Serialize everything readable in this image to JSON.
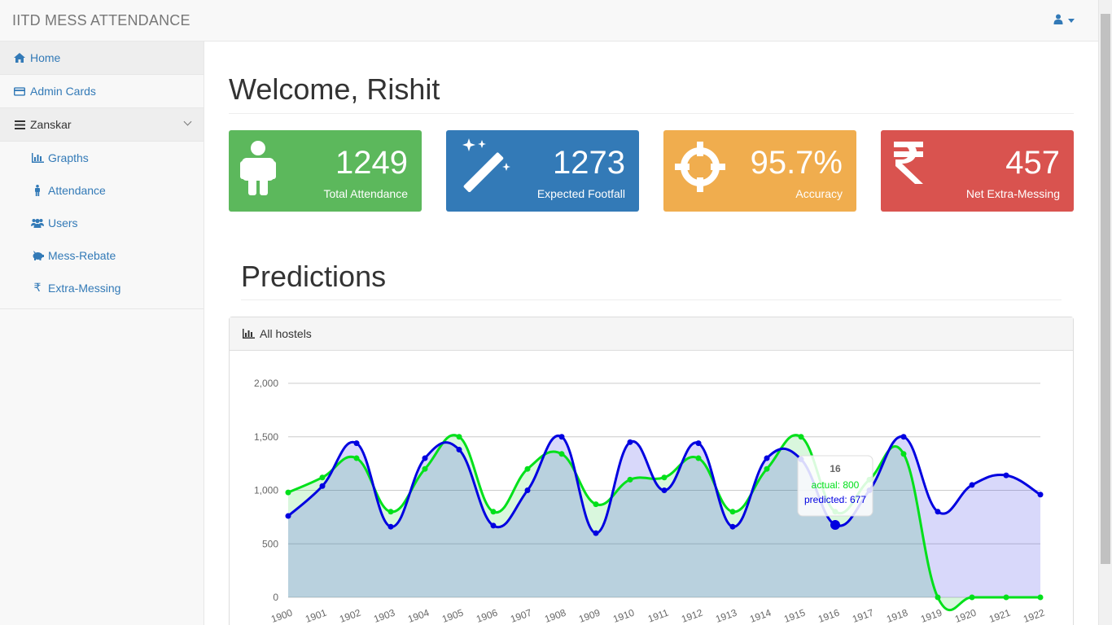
{
  "app": {
    "brand": "IITD MESS ATTENDANCE"
  },
  "header": {
    "user_icon": "user-icon"
  },
  "sidebar": {
    "items": [
      {
        "label": "Home",
        "icon": "home-icon"
      },
      {
        "label": "Admin Cards",
        "icon": "credit-card-icon"
      },
      {
        "label": "Zanskar",
        "icon": "bars-icon"
      }
    ],
    "sub_items": [
      {
        "label": "Grapths",
        "icon": "bar-chart-icon"
      },
      {
        "label": "Attendance",
        "icon": "male-icon"
      },
      {
        "label": "Users",
        "icon": "users-icon"
      },
      {
        "label": "Mess-Rebate",
        "icon": "piggy-bank-icon"
      },
      {
        "label": "Extra-Messing",
        "icon": "rupee-icon"
      }
    ]
  },
  "main": {
    "welcome": "Welcome, Rishit",
    "predictions_title": "Predictions",
    "panel_title": "All hostels"
  },
  "stats": [
    {
      "value": "1249",
      "label": "Total Attendance",
      "color": "#5cb85c",
      "icon": "male-icon"
    },
    {
      "value": "1273",
      "label": "Expected Footfall",
      "color": "#337ab7",
      "icon": "magic-wand-icon"
    },
    {
      "value": "95.7%",
      "label": "Accuracy",
      "color": "#f0ad4e",
      "icon": "crosshairs-icon"
    },
    {
      "value": "457",
      "label": "Net Extra-Messing",
      "color": "#d9534f",
      "icon": "rupee-icon"
    }
  ],
  "chart_data": {
    "type": "area",
    "x": [
      "1900",
      "1901",
      "1902",
      "1903",
      "1904",
      "1905",
      "1906",
      "1907",
      "1908",
      "1909",
      "1910",
      "1911",
      "1912",
      "1913",
      "1914",
      "1915",
      "1916",
      "1917",
      "1918",
      "1919",
      "1920",
      "1921",
      "1922"
    ],
    "ylim": [
      0,
      2000
    ],
    "yticks": [
      "0",
      "500",
      "1,000",
      "1,500",
      "2,000"
    ],
    "grid": true,
    "series": [
      {
        "name": "actual",
        "color": "#00e01a",
        "values": [
          980,
          1120,
          1300,
          800,
          1200,
          1500,
          800,
          1200,
          1340,
          870,
          1100,
          1120,
          1300,
          800,
          1200,
          1500,
          800,
          1100,
          1340,
          0,
          0,
          0,
          0
        ]
      },
      {
        "name": "predicted",
        "color": "#0000e0",
        "values": [
          760,
          1040,
          1440,
          660,
          1300,
          1380,
          670,
          1000,
          1500,
          600,
          1450,
          1000,
          1440,
          660,
          1300,
          1290,
          677,
          1000,
          1500,
          800,
          1050,
          1140,
          960
        ]
      }
    ],
    "tooltip": {
      "title": "16",
      "actual_text": "actual: 800",
      "predicted_text": "predicted: 677",
      "index": 16
    }
  }
}
